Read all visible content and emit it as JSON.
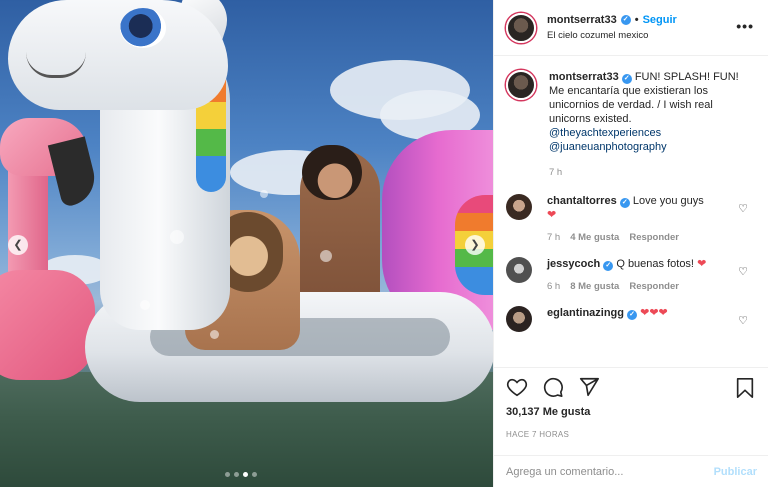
{
  "post": {
    "username": "montserrat33",
    "follow_separator": "•",
    "follow_label": "Seguir",
    "location": "El cielo cozumel mexico",
    "more_label": "•••"
  },
  "caption": {
    "username": "montserrat33",
    "text": "FUN! SPLASH! FUN! Me encantaría que existieran los unicornios de verdad. / I wish real unicorns existed.",
    "mentions": [
      "@theyachtexperiences",
      "@juaneuanphotography"
    ],
    "time": "7 h"
  },
  "comments": [
    {
      "username": "chantaltorres",
      "text": "Love you guys",
      "emoji": "❤",
      "time": "7 h",
      "likes": "4 Me gusta",
      "reply": "Responder"
    },
    {
      "username": "jessycoch",
      "text": "Q buenas fotos!",
      "emoji": "❤",
      "time": "6 h",
      "likes": "8 Me gusta",
      "reply": "Responder"
    },
    {
      "username": "eglantinazingg",
      "text": "",
      "emoji": "❤❤❤",
      "time": "",
      "likes": "",
      "reply": ""
    }
  ],
  "actions": {
    "likes": "30,137 Me gusta",
    "posted": "HACE 7 HORAS",
    "icons": [
      "heart-icon",
      "comment-icon",
      "share-icon",
      "bookmark-icon"
    ]
  },
  "add_comment": {
    "placeholder": "Agrega un comentario...",
    "publish_label": "Publicar"
  },
  "carousel": {
    "slides": 4,
    "active": 3
  },
  "colors": {
    "link": "#0095f6",
    "mention": "#00376b",
    "heart": "#ed4956",
    "meta": "#8e8e8e",
    "verified": "#3897f0"
  }
}
